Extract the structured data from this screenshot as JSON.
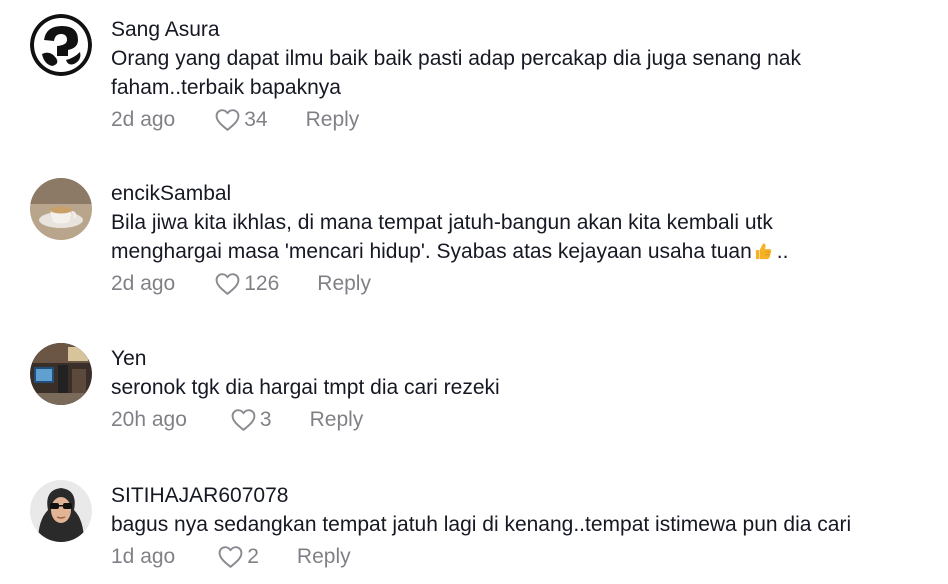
{
  "comments": [
    {
      "username": "Sang Asura",
      "text": "Orang yang dapat ilmu baik baik pasti adap percakap dia juga senang nak faham..terbaik bapaknya",
      "time": "2d ago",
      "likes": "34",
      "reply": "Reply",
      "avatar": "black-white-logo-avatar"
    },
    {
      "username": "encikSambal",
      "text_before_emoji": "Bila jiwa kita ikhlas, di mana tempat jatuh-bangun akan kita kembali utk menghargai masa 'mencari hidup'. Syabas atas kejayaan usaha tuan",
      "text_after_emoji": "..",
      "emoji": "thumbs-up-emoji",
      "time": "2d ago",
      "likes": "126",
      "reply": "Reply",
      "avatar": "coffee-cup-avatar"
    },
    {
      "username": "Yen",
      "text": "seronok tgk dia hargai tmpt dia cari rezeki",
      "time": "20h ago",
      "likes": "3",
      "reply": "Reply",
      "avatar": "room-photo-avatar"
    },
    {
      "username": "SITIHAJAR607078",
      "text": "bagus nya sedangkan tempat jatuh lagi di kenang..tempat istimewa pun dia cari",
      "time": "1d ago",
      "likes": "2",
      "reply": "Reply",
      "avatar": "woman-hijab-avatar"
    }
  ],
  "colors": {
    "text": "#161823",
    "meta": "#8a8b91",
    "emoji": "#f5b324"
  }
}
